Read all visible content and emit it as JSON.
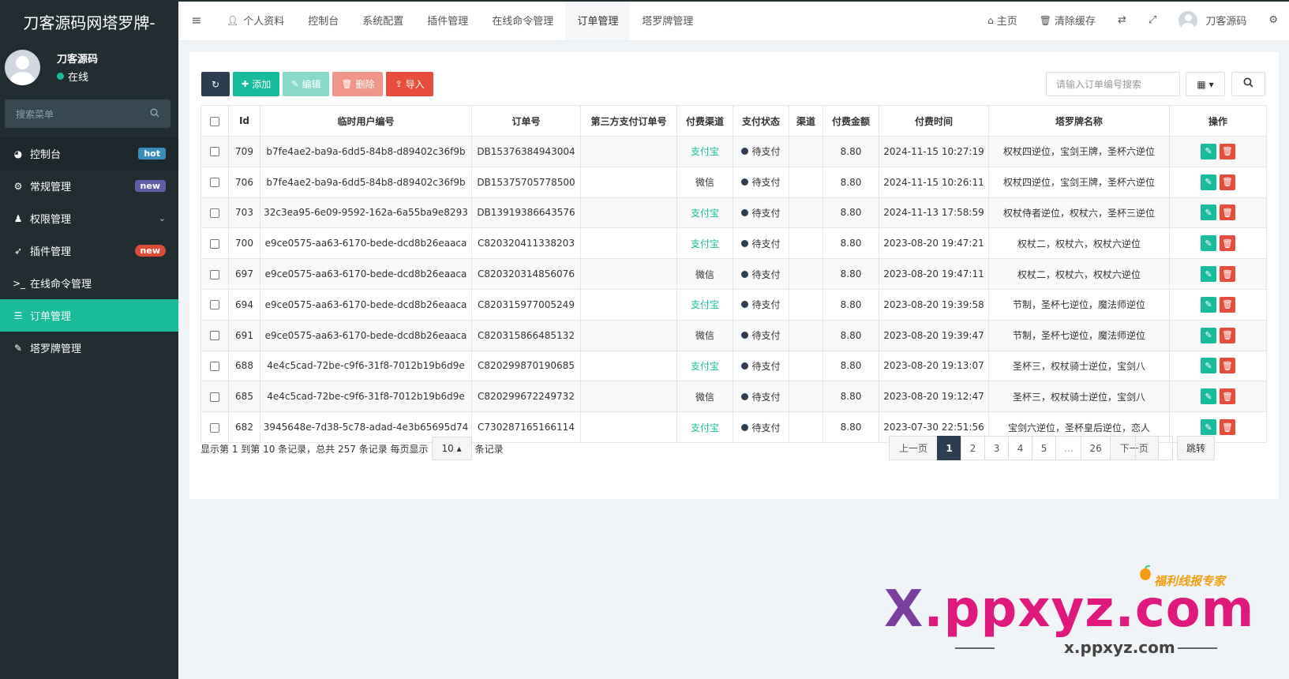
{
  "app": {
    "title": "刀客源码网塔罗牌-"
  },
  "user": {
    "name": "刀客源码",
    "status": "在线"
  },
  "sidebar": {
    "search_placeholder": "搜索菜单",
    "items": [
      {
        "label": "控制台",
        "icon": "dashboard-icon",
        "badge": "hot"
      },
      {
        "label": "常规管理",
        "icon": "cogs-icon",
        "badge": "new"
      },
      {
        "label": "权限管理",
        "icon": "group-icon",
        "badge": ""
      },
      {
        "label": "插件管理",
        "icon": "rocket-icon",
        "badge": "new"
      },
      {
        "label": "在线命令管理",
        "icon": "terminal-icon",
        "badge": ""
      },
      {
        "label": "订单管理",
        "icon": "list-icon",
        "badge": ""
      },
      {
        "label": "塔罗牌管理",
        "icon": "brush-icon",
        "badge": ""
      }
    ]
  },
  "topnav": {
    "tabs": [
      {
        "label": "个人资料",
        "icon": "user-icon"
      },
      {
        "label": "控制台"
      },
      {
        "label": "系统配置"
      },
      {
        "label": "插件管理"
      },
      {
        "label": "在线命令管理"
      },
      {
        "label": "订单管理"
      },
      {
        "label": "塔罗牌管理"
      }
    ],
    "home": "主页",
    "clear_cache": "清除缓存",
    "user_name": "刀客源码"
  },
  "toolbar": {
    "add": "添加",
    "edit": "编辑",
    "delete": "删除",
    "import": "导入",
    "search_placeholder": "请输入订单编号搜索"
  },
  "table": {
    "headers": [
      "Id",
      "临时用户编号",
      "订单号",
      "第三方支付订单号",
      "付费渠道",
      "支付状态",
      "渠道",
      "付费金额",
      "付费时间",
      "塔罗牌名称",
      "操作"
    ],
    "rows": [
      {
        "id": "709",
        "uid": "b7fe4ae2-ba9a-6dd5-84b8-d89402c36f9b",
        "order": "DB15376384943004",
        "third": "",
        "channel": "支付宝",
        "status": "待支付",
        "ch": "",
        "amount": "8.80",
        "time": "2024-11-15 10:27:19",
        "cards": "权杖四逆位，宝剑王牌，圣杯六逆位"
      },
      {
        "id": "706",
        "uid": "b7fe4ae2-ba9a-6dd5-84b8-d89402c36f9b",
        "order": "DB15375705778500",
        "third": "",
        "channel": "微信",
        "status": "待支付",
        "ch": "",
        "amount": "8.80",
        "time": "2024-11-15 10:26:11",
        "cards": "权杖四逆位，宝剑王牌，圣杯六逆位"
      },
      {
        "id": "703",
        "uid": "32c3ea95-6e09-9592-162a-6a55ba9e8293",
        "order": "DB13919386643576",
        "third": "",
        "channel": "支付宝",
        "status": "待支付",
        "ch": "",
        "amount": "8.80",
        "time": "2024-11-13 17:58:59",
        "cards": "权杖侍者逆位，权杖六，圣杯三逆位"
      },
      {
        "id": "700",
        "uid": "e9ce0575-aa63-6170-bede-dcd8b26eaaca",
        "order": "C820320411338203",
        "third": "",
        "channel": "支付宝",
        "status": "待支付",
        "ch": "",
        "amount": "8.80",
        "time": "2023-08-20 19:47:21",
        "cards": "权杖二，权杖六，权杖六逆位"
      },
      {
        "id": "697",
        "uid": "e9ce0575-aa63-6170-bede-dcd8b26eaaca",
        "order": "C820320314856076",
        "third": "",
        "channel": "微信",
        "status": "待支付",
        "ch": "",
        "amount": "8.80",
        "time": "2023-08-20 19:47:11",
        "cards": "权杖二，权杖六，权杖六逆位"
      },
      {
        "id": "694",
        "uid": "e9ce0575-aa63-6170-bede-dcd8b26eaaca",
        "order": "C820315977005249",
        "third": "",
        "channel": "支付宝",
        "status": "待支付",
        "ch": "",
        "amount": "8.80",
        "time": "2023-08-20 19:39:58",
        "cards": "节制，圣杯七逆位，魔法师逆位"
      },
      {
        "id": "691",
        "uid": "e9ce0575-aa63-6170-bede-dcd8b26eaaca",
        "order": "C820315866485132",
        "third": "",
        "channel": "微信",
        "status": "待支付",
        "ch": "",
        "amount": "8.80",
        "time": "2023-08-20 19:39:47",
        "cards": "节制，圣杯七逆位，魔法师逆位"
      },
      {
        "id": "688",
        "uid": "4e4c5cad-72be-c9f6-31f8-7012b19b6d9e",
        "order": "C820299870190685",
        "third": "",
        "channel": "支付宝",
        "status": "待支付",
        "ch": "",
        "amount": "8.80",
        "time": "2023-08-20 19:13:07",
        "cards": "圣杯三，权杖骑士逆位，宝剑八"
      },
      {
        "id": "685",
        "uid": "4e4c5cad-72be-c9f6-31f8-7012b19b6d9e",
        "order": "C820299672249732",
        "third": "",
        "channel": "微信",
        "status": "待支付",
        "ch": "",
        "amount": "8.80",
        "time": "2023-08-20 19:12:47",
        "cards": "圣杯三，权杖骑士逆位，宝剑八"
      },
      {
        "id": "682",
        "uid": "3945648e-7d38-5c78-adad-4e3b65695d74",
        "order": "C730287165166114",
        "third": "",
        "channel": "支付宝",
        "status": "待支付",
        "ch": "",
        "amount": "8.80",
        "time": "2023-07-30 22:51:56",
        "cards": "宝剑六逆位，圣杯皇后逆位，恋人"
      }
    ]
  },
  "footer": {
    "info": "显示第 1 到第 10 条记录，总共 257 条记录 每页显示",
    "page_size": "10",
    "suffix": "条记录",
    "pages": [
      "上一页",
      "1",
      "2",
      "3",
      "4",
      "5",
      "...",
      "26",
      "下一页"
    ],
    "current_page": "1",
    "jump": "跳转"
  },
  "watermark": {
    "tag": "福利线报专家",
    "brand_x": "X",
    "brand_rest": ".ppxyz.com",
    "sub": "x.ppxyz.com"
  },
  "colors": {
    "sidebar_bg": "#222d32",
    "accent": "#18bc9c",
    "danger": "#e74c3c",
    "dark": "#2c3e50"
  }
}
